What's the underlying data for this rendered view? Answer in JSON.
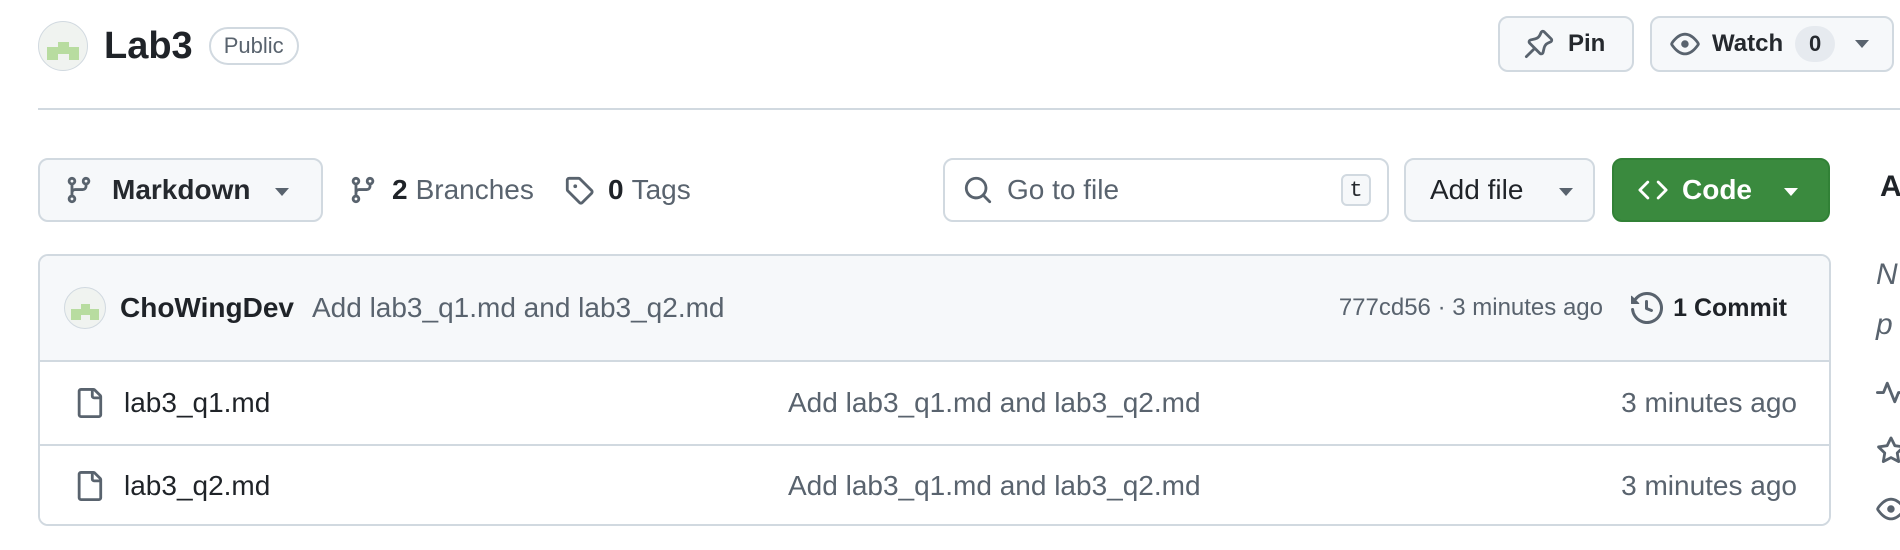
{
  "header": {
    "repo_name": "Lab3",
    "visibility": "Public",
    "pin_label": "Pin",
    "watch_label": "Watch",
    "watch_count": "0"
  },
  "toolbar": {
    "branch_name": "Markdown",
    "branches_count": "2",
    "branches_label": "Branches",
    "tags_count": "0",
    "tags_label": "Tags",
    "search_placeholder": "Go to file",
    "search_shortcut": "t",
    "add_file_label": "Add file",
    "code_label": "Code"
  },
  "latest_commit": {
    "author": "ChoWingDev",
    "message": "Add lab3_q1.md and lab3_q2.md",
    "meta": "777cd56 · 3 minutes ago",
    "commits_label": "1 Commit"
  },
  "files": [
    {
      "name": "lab3_q1.md",
      "commit": "Add lab3_q1.md and lab3_q2.md",
      "time": "3 minutes ago"
    },
    {
      "name": "lab3_q2.md",
      "commit": "Add lab3_q1.md and lab3_q2.md",
      "time": "3 minutes ago"
    }
  ],
  "sidebar": {
    "about_heading": "A",
    "description_line1": "N",
    "description_line2": "p"
  },
  "icons": {
    "pin": "pin-icon",
    "eye": "eye-icon",
    "branch": "git-branch-icon",
    "tag": "tag-icon",
    "search": "search-icon",
    "code": "code-icon",
    "history": "history-icon",
    "file": "file-icon"
  },
  "colors": {
    "code_button": "#3a8a3e",
    "border": "#d1d9e0",
    "muted_text": "#59636e"
  }
}
